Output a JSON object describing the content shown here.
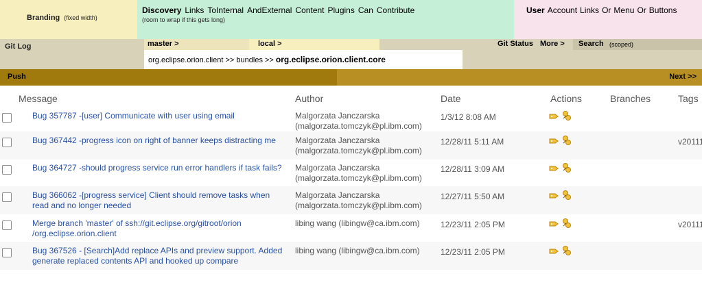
{
  "banner": {
    "branding": {
      "title": "Branding",
      "subtitle": "(fixed width)"
    },
    "discovery": {
      "links": [
        "Discovery",
        "Links",
        "ToInternal",
        "AndExternal",
        "Content",
        "Plugins",
        "Can",
        "Contribute"
      ],
      "note": "(room to wrap if this gets long)"
    },
    "user": {
      "links": [
        "User",
        "Account",
        "Links",
        "Or",
        "Menu",
        "Or",
        "Buttons"
      ]
    }
  },
  "gitbar": {
    "title": "Git Log",
    "master": "master >",
    "local": "local >",
    "git_status": "Git Status",
    "more": "More >",
    "search": "Search",
    "search_scope": "(scoped)",
    "breadcrumb": {
      "path": "org.eclipse.orion.client >> bundles >> ",
      "current": "org.eclipse.orion.client.core"
    }
  },
  "actionbar": {
    "push": "Push",
    "next": "Next >>"
  },
  "table": {
    "headers": {
      "message": "Message",
      "author": "Author",
      "date": "Date",
      "actions": "Actions",
      "branches": "Branches",
      "tags": "Tags"
    },
    "rows": [
      {
        "message": "Bug 357787 -[user] Communicate with user using email",
        "author_name": "Malgorzata Janczarska",
        "author_email": "(malgorzata.tomczyk@pl.ibm.com)",
        "date": "1/3/12 8:08 AM",
        "tag": ""
      },
      {
        "message": "Bug 367442 -progress icon on right of banner keeps distracting me",
        "author_name": "Malgorzata Janczarska",
        "author_email": "(malgorzata.tomczyk@pl.ibm.com)",
        "date": "12/28/11 5:11 AM",
        "tag": "v20111"
      },
      {
        "message": "Bug 364727 -should progress service run error handlers if task fails?",
        "author_name": "Malgorzata Janczarska",
        "author_email": "(malgorzata.tomczyk@pl.ibm.com)",
        "date": "12/28/11 3:09 AM",
        "tag": ""
      },
      {
        "message": "Bug 366062 -[progress service] Client should remove tasks when read and no longer needed",
        "author_name": "Malgorzata Janczarska",
        "author_email": "(malgorzata.tomczyk@pl.ibm.com)",
        "date": "12/27/11 5:50 AM",
        "tag": ""
      },
      {
        "message": "Merge branch 'master' of ssh://git.eclipse.org/gitroot/orion /org.eclipse.orion.client",
        "author_name": "libing wang (libingw@ca.ibm.com)",
        "author_email": "",
        "date": "12/23/11 2:05 PM",
        "tag": "v20111"
      },
      {
        "message": "Bug 367526 - [Search]Add replace APIs and preview support. Added generate replaced contents API and hooked up compare",
        "author_name": "libing wang (libingw@ca.ibm.com)",
        "author_email": "",
        "date": "12/23/11 2:05 PM",
        "tag": ""
      }
    ]
  },
  "icons": {
    "tag": "tag-icon",
    "rebase": "rebase-icon"
  },
  "colors": {
    "branding_bg": "#f7efbd",
    "discovery_bg": "#c6efd8",
    "user_bg": "#f8e3ec",
    "gitbar_bg": "#d7d2b8",
    "push_bg": "#a07a0d",
    "next_bg": "#b88f22",
    "link": "#2750a6"
  }
}
